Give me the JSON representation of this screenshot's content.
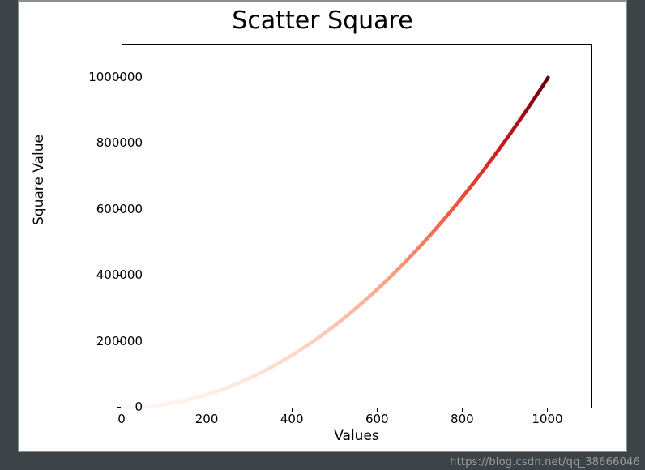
{
  "chart_data": {
    "type": "scatter",
    "title": "Scatter Square",
    "xlabel": "Values",
    "ylabel": "Square Value",
    "xlim": [
      0,
      1100
    ],
    "ylim": [
      0,
      1100000
    ],
    "xticks": [
      0,
      200,
      400,
      600,
      800,
      1000
    ],
    "yticks": [
      0,
      200000,
      400000,
      600000,
      800000,
      1000000
    ],
    "x": "1..1000 step 1",
    "y": "x*x",
    "sample_points": [
      {
        "x": 0,
        "y": 0
      },
      {
        "x": 100,
        "y": 10000
      },
      {
        "x": 200,
        "y": 40000
      },
      {
        "x": 300,
        "y": 90000
      },
      {
        "x": 400,
        "y": 160000
      },
      {
        "x": 500,
        "y": 250000
      },
      {
        "x": 600,
        "y": 360000
      },
      {
        "x": 700,
        "y": 490000
      },
      {
        "x": 800,
        "y": 640000
      },
      {
        "x": 900,
        "y": 810000
      },
      {
        "x": 1000,
        "y": 1000000
      }
    ],
    "colormap": "Reds",
    "color_stops": [
      {
        "t": 0.0,
        "hex": "#fff5f0"
      },
      {
        "t": 0.2,
        "hex": "#fdd1be"
      },
      {
        "t": 0.4,
        "hex": "#fc9f81"
      },
      {
        "t": 0.6,
        "hex": "#f6583e"
      },
      {
        "t": 0.8,
        "hex": "#ca181d"
      },
      {
        "t": 1.0,
        "hex": "#67000d"
      }
    ]
  },
  "watermark": "https://blog.csdn.net/qq_38666046"
}
